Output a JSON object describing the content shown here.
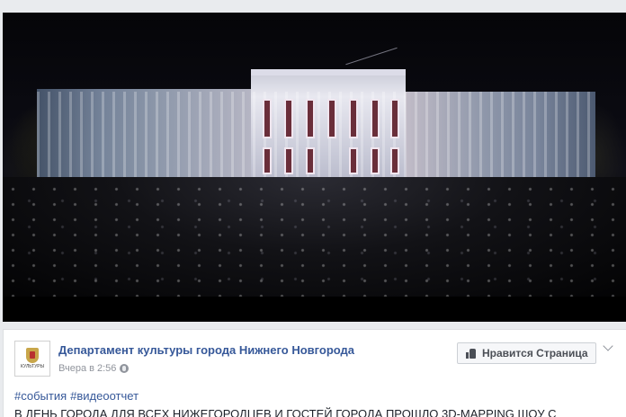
{
  "video": {
    "description_icons": [
      "play-area"
    ]
  },
  "post": {
    "page_name": "Департамент культуры города Нижнего Новгорода",
    "avatar_caption": "КУЛЬТУРЫ",
    "timestamp": "Вчера в 2:56",
    "like_button_label": "Нравится Страница",
    "hashtags": [
      "#события",
      "#видеоотчет"
    ],
    "text": "В ДЕНЬ ГОРОДА ДЛЯ ВСЕХ НИЖЕГОРОДЦЕВ И ГОСТЕЙ ГОРОДА ПРОШЛО 3D-MAPPING ШОУ С"
  },
  "colors": {
    "link": "#365899",
    "background": "#e9ebee",
    "muted": "#90949c"
  }
}
